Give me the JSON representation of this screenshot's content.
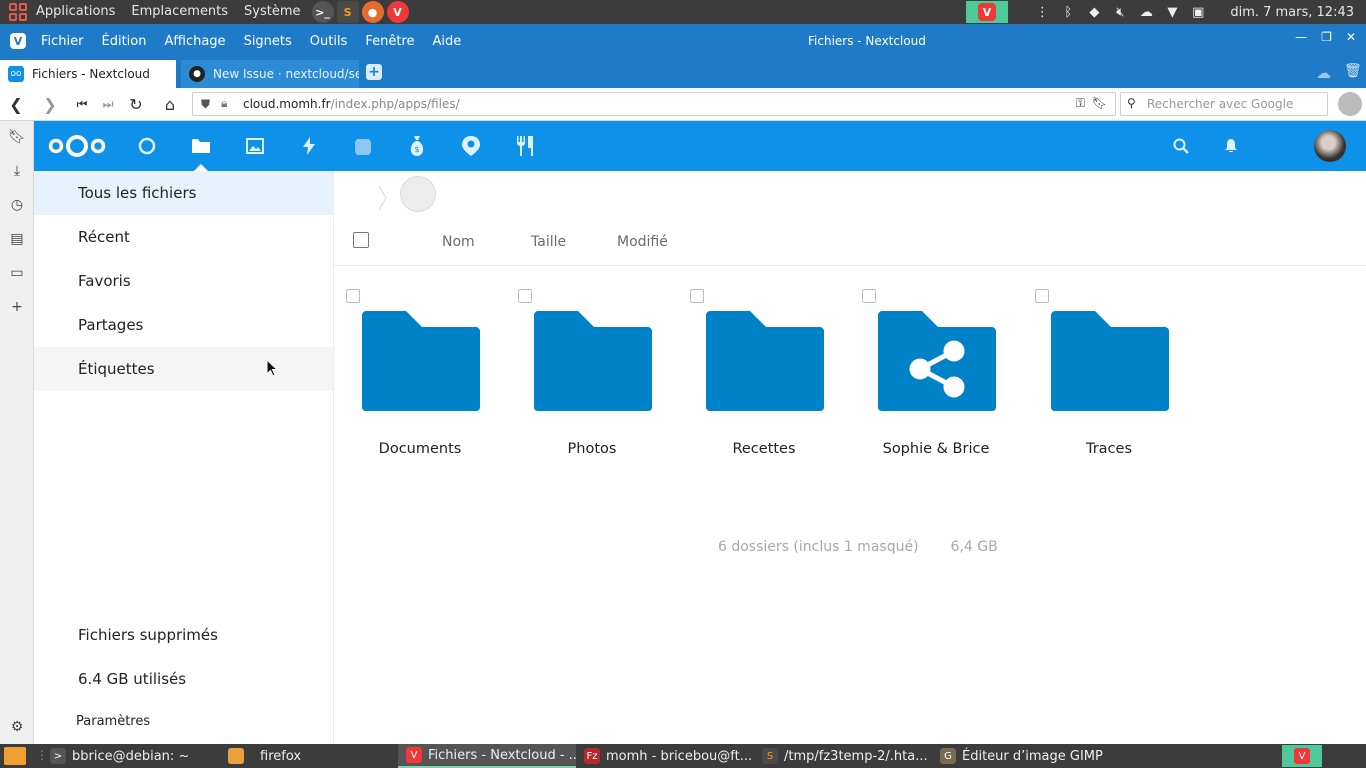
{
  "os_panel": {
    "menus": [
      "Applications",
      "Emplacements",
      "Système"
    ],
    "clock": "dim. 7 mars, 12:43"
  },
  "browser": {
    "menus": [
      "Fichier",
      "Édition",
      "Affichage",
      "Signets",
      "Outils",
      "Fenêtre",
      "Aide"
    ],
    "window_title": "Fichiers - Nextcloud",
    "tabs": [
      {
        "label": "Fichiers - Nextcloud"
      },
      {
        "label": "New Issue · nextcloud/server"
      }
    ],
    "url_host": "cloud.momh.fr",
    "url_path": "/index.php/apps/files/",
    "search_placeholder": "Rechercher avec Google"
  },
  "nav": {
    "items": [
      {
        "label": "Tous les fichiers"
      },
      {
        "label": "Récent"
      },
      {
        "label": "Favoris"
      },
      {
        "label": "Partages"
      },
      {
        "label": "Étiquettes"
      }
    ],
    "bottom": [
      {
        "label": "Fichiers supprimés"
      },
      {
        "label": "6.4 GB utilisés"
      }
    ],
    "settings": "Paramètres"
  },
  "files": {
    "columns": {
      "name": "Nom",
      "size": "Taille",
      "modified": "Modifié"
    },
    "folders": [
      {
        "name": "Documents",
        "shared": false
      },
      {
        "name": "Photos",
        "shared": false
      },
      {
        "name": "Recettes",
        "shared": false
      },
      {
        "name": "Sophie & Brice",
        "shared": true
      },
      {
        "name": "Traces",
        "shared": false
      }
    ],
    "summary_count": "6 dossiers (inclus 1 masqué)",
    "summary_size": "6,4 GB"
  },
  "taskbar": {
    "tasks": [
      {
        "label": "bbrice@debian: ~"
      },
      {
        "label": "firefox"
      },
      {
        "label": "Fichiers - Nextcloud - ..."
      },
      {
        "label": "momh - bricebou@ft..."
      },
      {
        "label": "/tmp/fz3temp-2/.hta..."
      },
      {
        "label": "Éditeur d’image GIMP"
      }
    ]
  },
  "colors": {
    "nextcloud_blue": "#0e91e8",
    "folder_blue": "#0082c9",
    "browser_blue": "#1f7bc7",
    "vivaldi_red": "#ef3939"
  }
}
